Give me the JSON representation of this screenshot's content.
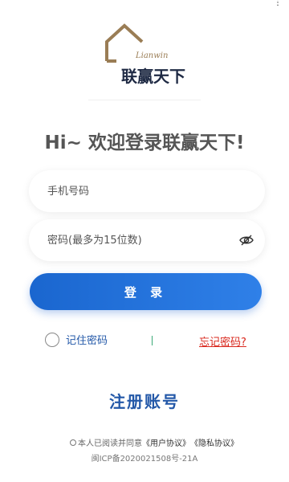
{
  "statusbar": {
    "dots": "⋮"
  },
  "logo": {
    "en": "Lianwin",
    "cn": "联赢天下",
    "color": "#9a7d55"
  },
  "welcome": "Hi~ 欢迎登录联赢天下!",
  "phone": {
    "placeholder": "手机号码"
  },
  "password": {
    "placeholder": "密码(最多为15位数)",
    "toggle_icon": "eye-hidden-icon"
  },
  "login_button": "登 录",
  "remember": "记住密码",
  "forgot": "忘记密码?",
  "register": "注册账号",
  "agreement": {
    "prefix": "本人已阅读并同意",
    "user": "《用户协议》",
    "privacy": "《隐私协议》"
  },
  "icp": "闽ICP备2020021508号-21A",
  "colors": {
    "primary": "#1a66cf",
    "link": "#2358a8",
    "danger": "#d9281e"
  }
}
